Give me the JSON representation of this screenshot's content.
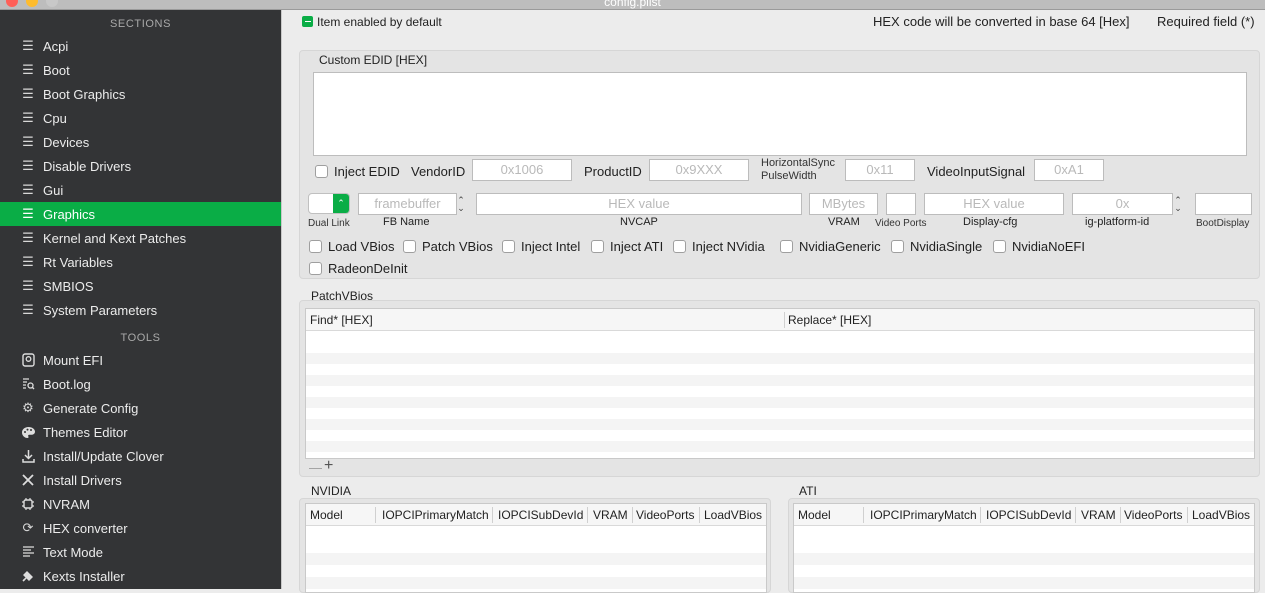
{
  "window": {
    "title": "config.plist"
  },
  "sidebar": {
    "sections_heading": "SECTIONS",
    "tools_heading": "TOOLS",
    "sections": [
      {
        "label": "Acpi",
        "icon": "list-icon"
      },
      {
        "label": "Boot",
        "icon": "list-icon"
      },
      {
        "label": "Boot Graphics",
        "icon": "list-icon"
      },
      {
        "label": "Cpu",
        "icon": "list-icon"
      },
      {
        "label": "Devices",
        "icon": "list-icon"
      },
      {
        "label": "Disable Drivers",
        "icon": "list-icon"
      },
      {
        "label": "Gui",
        "icon": "list-icon"
      },
      {
        "label": "Graphics",
        "icon": "list-icon"
      },
      {
        "label": "Kernel and Kext Patches",
        "icon": "list-icon"
      },
      {
        "label": "Rt Variables",
        "icon": "list-icon"
      },
      {
        "label": "SMBIOS",
        "icon": "list-icon"
      },
      {
        "label": "System Parameters",
        "icon": "list-icon"
      }
    ],
    "tools": [
      {
        "label": "Mount EFI",
        "icon": "disk-icon"
      },
      {
        "label": "Boot.log",
        "icon": "log-search-icon"
      },
      {
        "label": "Generate Config",
        "icon": "gears-icon"
      },
      {
        "label": "Themes Editor",
        "icon": "palette-icon"
      },
      {
        "label": "Install/Update Clover",
        "icon": "download-icon"
      },
      {
        "label": "Install Drivers",
        "icon": "tools-icon"
      },
      {
        "label": "NVRAM",
        "icon": "chip-icon"
      },
      {
        "label": "HEX converter",
        "icon": "refresh-icon"
      },
      {
        "label": "Text Mode",
        "icon": "text-lines-icon"
      },
      {
        "label": "Kexts Installer",
        "icon": "plug-icon"
      }
    ]
  },
  "header": {
    "enabled_legend": "Item enabled by default",
    "hex_note": "HEX code will be converted in base 64 [Hex]",
    "required_note": "Required field (*)"
  },
  "edid": {
    "section_title": "Custom EDID [HEX]",
    "inject_edid": "Inject EDID",
    "vendor_label": "VendorID",
    "vendor_placeholder": "0x1006",
    "product_label": "ProductID",
    "product_placeholder": "0x9XXX",
    "hsync_label_1": "HorizontalSync",
    "hsync_label_2": "PulseWidth",
    "hsync_placeholder": "0x11",
    "video_input_label": "VideoInputSignal",
    "video_input_placeholder": "0xA1"
  },
  "graphics_fields": {
    "dual_link_label": "Dual Link",
    "fb_name_placeholder": "framebuffer",
    "fb_name_label": "FB Name",
    "nvcap_placeholder": "HEX value",
    "nvcap_label": "NVCAP",
    "vram_placeholder": "MBytes",
    "vram_label": "VRAM",
    "video_ports_label": "Video Ports",
    "display_cfg_placeholder": "HEX value",
    "display_cfg_label": "Display-cfg",
    "ig_platform_placeholder": "0x",
    "ig_platform_label": "ig-platform-id",
    "boot_display_label": "BootDisplay"
  },
  "checkboxes": [
    "Load VBios",
    "Patch VBios",
    "Inject Intel",
    "Inject ATI",
    "Inject NVidia",
    "NvidiaGeneric",
    "NvidiaSingle",
    "NvidiaNoEFI",
    "RadeonDeInit"
  ],
  "patch_vbios": {
    "title": "PatchVBios",
    "columns": [
      "Find* [HEX]",
      "Replace* [HEX]"
    ],
    "remove_label": "—",
    "add_label": "+"
  },
  "nvidia": {
    "title": "NVIDIA",
    "columns": [
      "Model",
      "IOPCIPrimaryMatch",
      "IOPCISubDevId",
      "VRAM",
      "VideoPorts",
      "LoadVBios"
    ]
  },
  "ati": {
    "title": "ATI",
    "columns": [
      "Model",
      "IOPCIPrimaryMatch",
      "IOPCISubDevId",
      "VRAM",
      "VideoPorts",
      "LoadVBios"
    ]
  },
  "colors": {
    "accent": "#0aad46",
    "sidebar_bg": "#333436",
    "close": "#ff5f57",
    "minimize": "#febc2e",
    "zoom": "#c8c8c8"
  }
}
